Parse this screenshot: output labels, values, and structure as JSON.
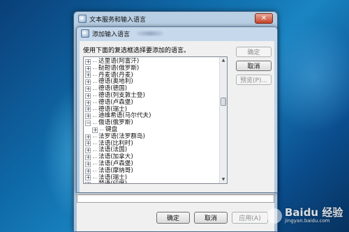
{
  "outer_window": {
    "title": "文本服务和输入语言",
    "close_label": "✕",
    "buttons": {
      "ok": "确定",
      "cancel": "取消",
      "apply": "应用(A)"
    }
  },
  "dialog": {
    "title": "添加输入语言",
    "instruction": "使用下面的复选框选择要添加的语言。",
    "buttons": {
      "ok": "确定",
      "cancel": "取消",
      "preview": "预览(P)..."
    },
    "languages": [
      {
        "label": "达里语(阿富汗)",
        "type": "parent"
      },
      {
        "label": "鞑靼语(俄罗斯)",
        "type": "parent"
      },
      {
        "label": "丹麦语(丹麦)",
        "type": "parent"
      },
      {
        "label": "德语(奥地利)",
        "type": "parent"
      },
      {
        "label": "德语(德国)",
        "type": "parent"
      },
      {
        "label": "德语(列支敦士登)",
        "type": "parent"
      },
      {
        "label": "德语(卢森堡)",
        "type": "parent"
      },
      {
        "label": "德语(瑞士)",
        "type": "parent"
      },
      {
        "label": "迪维希语(马尔代夫)",
        "type": "parent"
      },
      {
        "label": "俄语(俄罗斯)",
        "type": "expanded"
      },
      {
        "label": "键盘",
        "type": "child"
      },
      {
        "label": "法罗语(法罗群岛)",
        "type": "parent"
      },
      {
        "label": "法语(比利时)",
        "type": "parent"
      },
      {
        "label": "法语(法国)",
        "type": "parent"
      },
      {
        "label": "法语(加拿大)",
        "type": "parent"
      },
      {
        "label": "法语(卢森堡)",
        "type": "parent"
      },
      {
        "label": "法语(摩纳哥)",
        "type": "parent"
      },
      {
        "label": "法语(瑞士)",
        "type": "parent"
      },
      {
        "label": "梵语(印度)",
        "type": "parent"
      }
    ]
  },
  "watermark": {
    "brand": "Baidu 经验",
    "url": "jingyan.baidu.com"
  }
}
